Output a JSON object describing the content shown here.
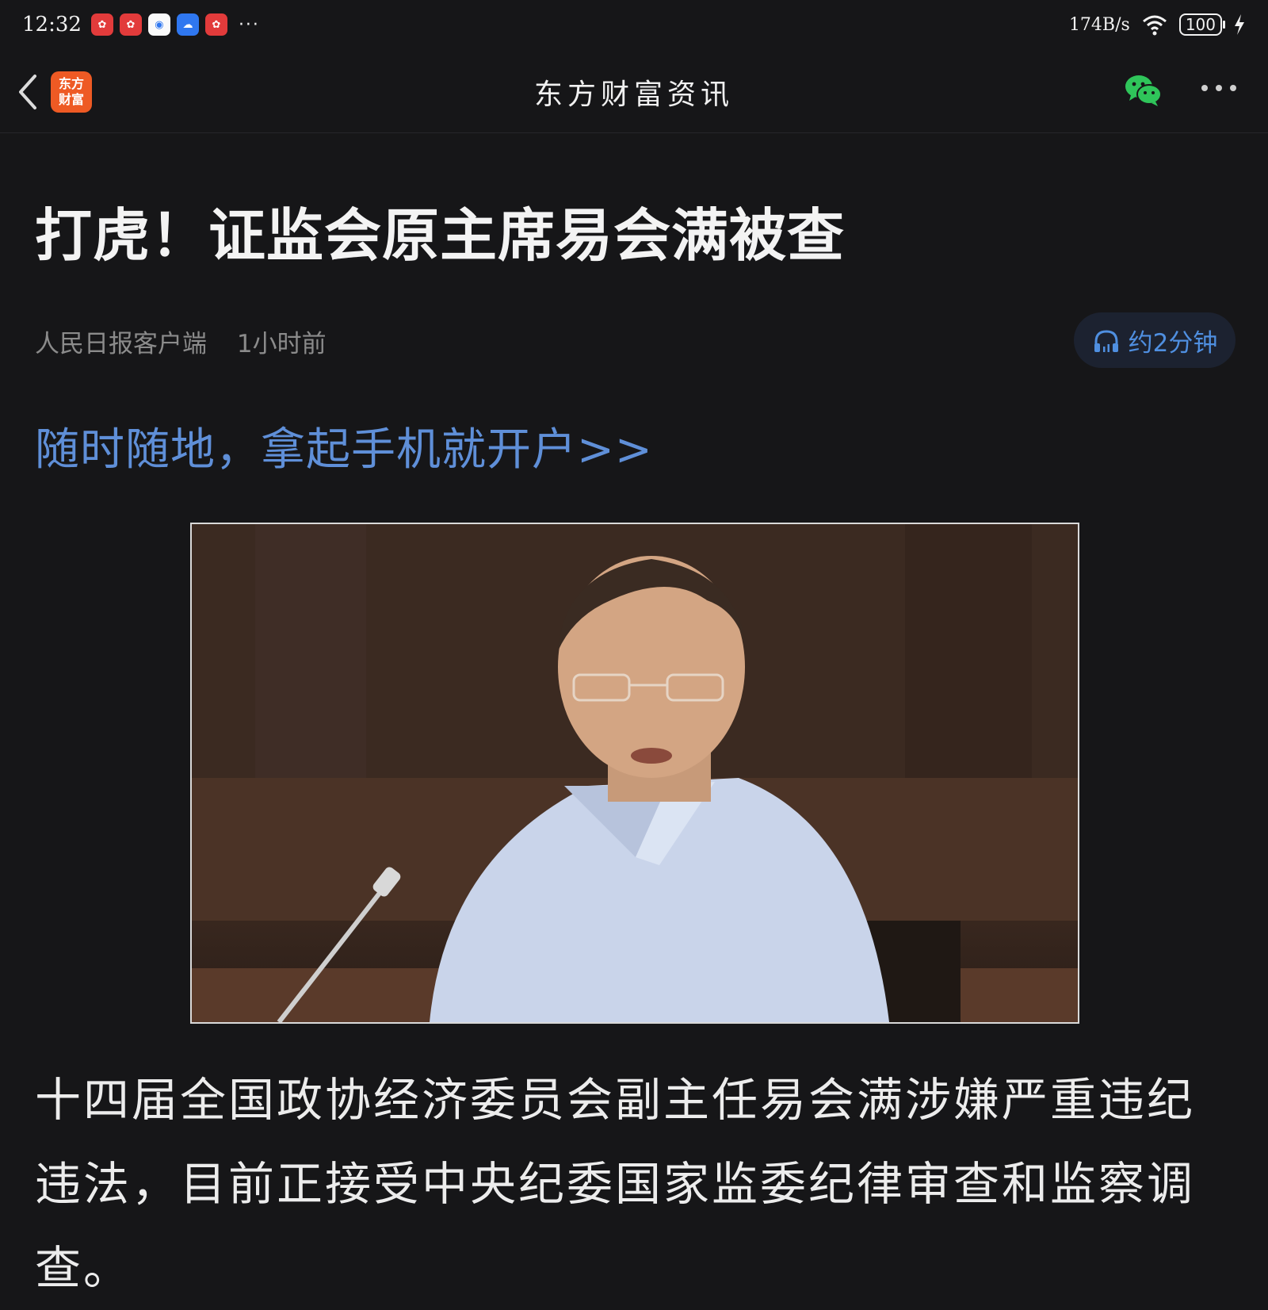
{
  "status_bar": {
    "time": "12:32",
    "app_icons": [
      "app-notification-icon",
      "app-notification-icon",
      "browser-icon",
      "cloud-icon",
      "app-notification-icon"
    ],
    "more": "···",
    "network_speed": "174B/s",
    "battery": "100"
  },
  "nav": {
    "brand_line1": "东方",
    "brand_line2": "财富",
    "title": "东方财富资讯"
  },
  "article": {
    "headline": "打虎！证监会原主席易会满被查",
    "source": "人民日报客户端",
    "time_ago": "1小时前",
    "listen_label": "约2分钟",
    "promo_link": "随时随地，拿起手机就开户>>",
    "body": "十四届全国政协经济委员会副主任易会满涉嫌严重违纪违法，目前正接受中央纪委国家监委纪律审查和监察调查。"
  },
  "colors": {
    "background": "#161618",
    "link_blue": "#5f8fd8",
    "brand_orange": "#ee5a24",
    "wechat_green": "#2fc55a"
  }
}
